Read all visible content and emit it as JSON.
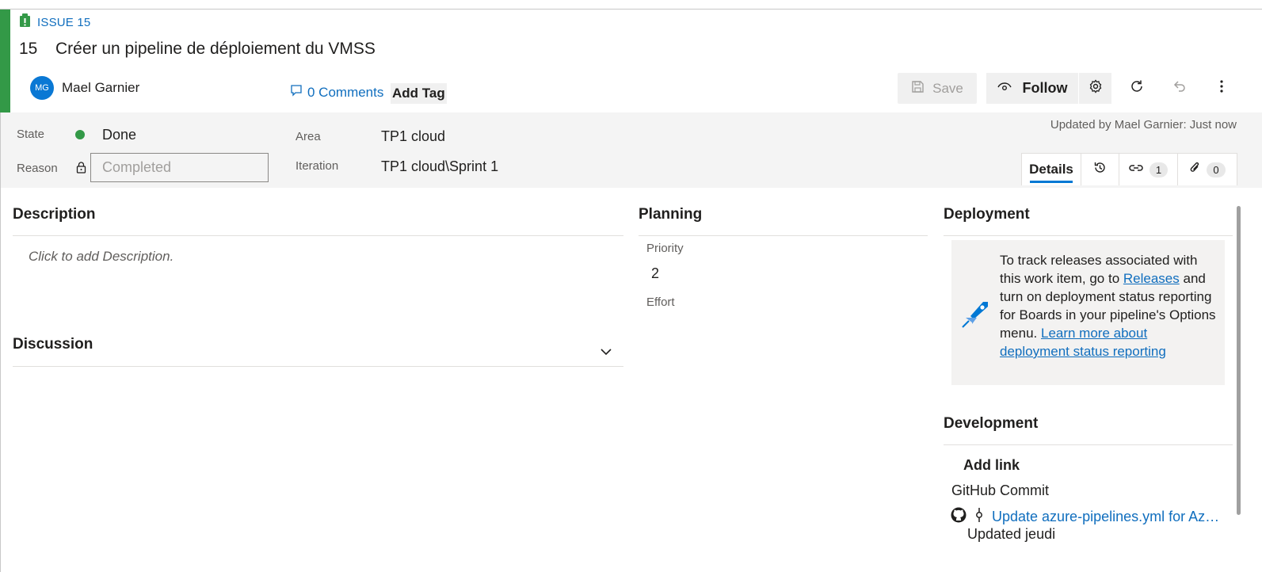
{
  "header": {
    "type_label": "ISSUE 15",
    "id": "15",
    "title": "Créer un pipeline de déploiement du VMSS",
    "assignee_initials": "MG",
    "assignee_name": "Mael Garnier",
    "comments_label": "0 Comments",
    "add_tag_label": "Add Tag"
  },
  "toolbar": {
    "save_label": "Save",
    "follow_label": "Follow"
  },
  "fields": {
    "state_label": "State",
    "state_value": "Done",
    "reason_label": "Reason",
    "reason_value": "Completed",
    "area_label": "Area",
    "area_value": "TP1 cloud",
    "iteration_label": "Iteration",
    "iteration_value": "TP1 cloud\\Sprint 1",
    "updated_text": "Updated by Mael Garnier: Just now"
  },
  "tabs": {
    "details_label": "Details",
    "links_count": "1",
    "attachments_count": "0"
  },
  "description": {
    "title": "Description",
    "placeholder": "Click to add Description."
  },
  "discussion": {
    "title": "Discussion"
  },
  "planning": {
    "title": "Planning",
    "priority_label": "Priority",
    "priority_value": "2",
    "effort_label": "Effort"
  },
  "deployment": {
    "title": "Deployment",
    "text_1": "To track releases associated with this work item, go to ",
    "releases_link": "Releases",
    "text_2": " and turn on deployment status reporting for Boards in your pipeline's Options menu. ",
    "learn_link": "Learn more about deployment status reporting"
  },
  "development": {
    "title": "Development",
    "add_link_label": "Add link",
    "github_label": "GitHub Commit",
    "commit_title": "Update azure-pipelines.yml for Azure Pipelines",
    "commit_updated": "Updated jeudi"
  },
  "colors": {
    "accent": "#339947",
    "link": "#106ebe",
    "primary": "#0078d4"
  }
}
